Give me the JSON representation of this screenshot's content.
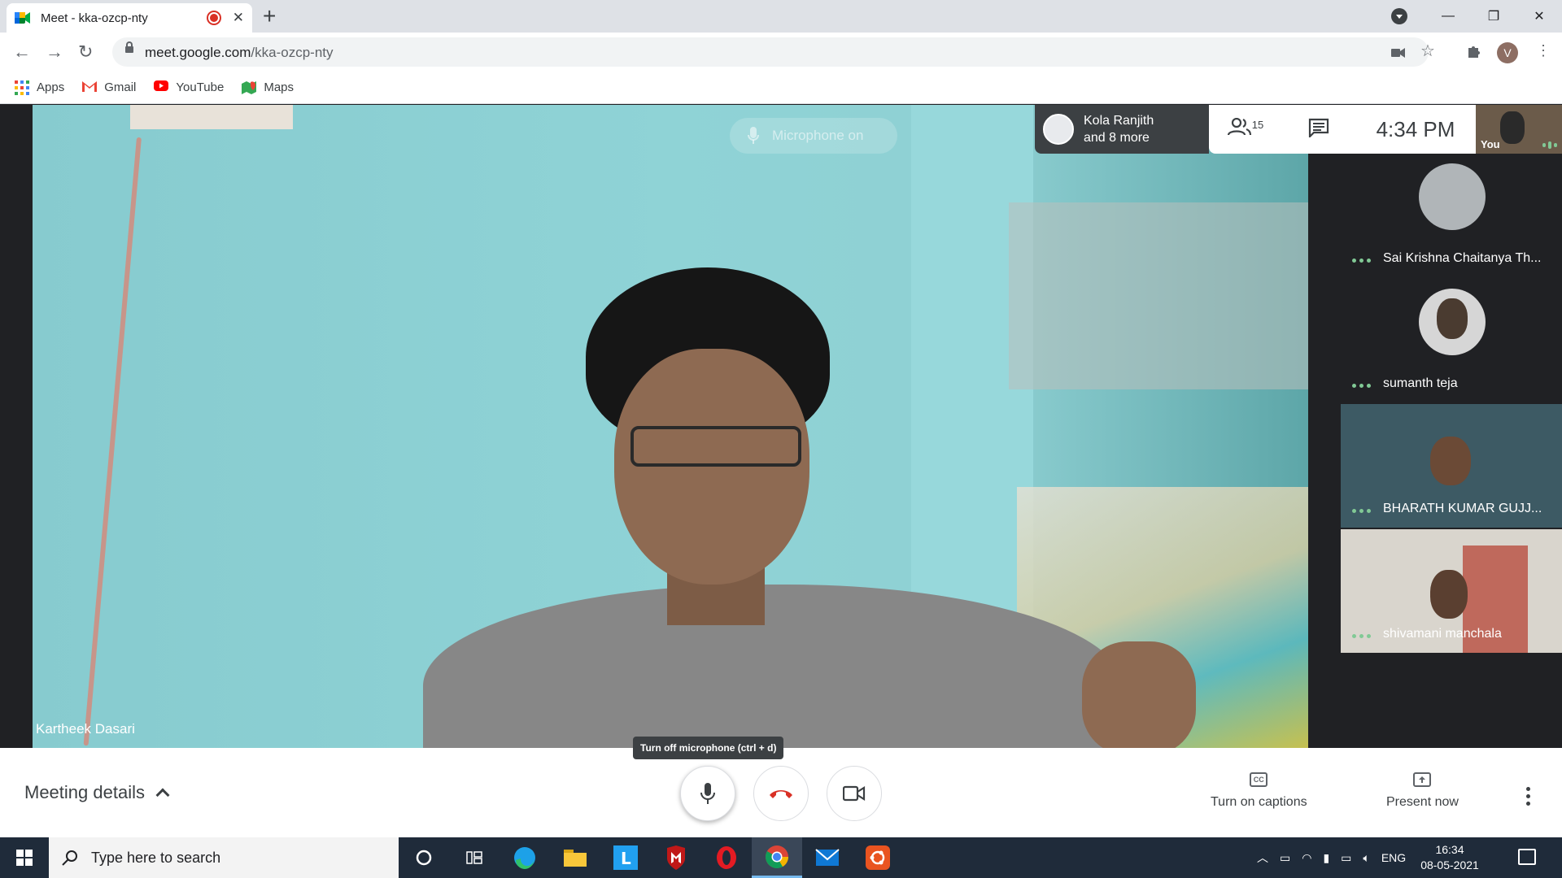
{
  "browser": {
    "tab_title": "Meet - kka-ozcp-nty",
    "url_host": "meet.google.com",
    "url_path": "/kka-ozcp-nty",
    "bookmarks": [
      {
        "label": "Apps"
      },
      {
        "label": "Gmail"
      },
      {
        "label": "YouTube"
      },
      {
        "label": "Maps"
      }
    ],
    "profile_initial": "V"
  },
  "meet": {
    "mic_status": "Microphone on",
    "main_speaker": "Kartheek Dasari",
    "pinned_summary_line1": "Kola Ranjith",
    "pinned_summary_line2": "and 8 more",
    "participant_count": "15",
    "time": "4:34 PM",
    "self_label": "You",
    "side_participants": [
      {
        "name": "Sai Krishna Chaitanya Th..."
      },
      {
        "name": "sumanth teja"
      },
      {
        "name": "BHARATH KUMAR GUJJ..."
      },
      {
        "name": "shivamani manchala"
      }
    ],
    "tooltip": "Turn off microphone (ctrl + d)",
    "meeting_details": "Meeting details",
    "captions_label": "Turn on captions",
    "captions_icon_text": "CC",
    "present_label": "Present now"
  },
  "taskbar": {
    "search_placeholder": "Type here to search",
    "language": "ENG",
    "time": "16:34",
    "date": "08-05-2021"
  },
  "colors": {
    "hangup_red": "#d93025",
    "meet_blue": "#8ab4f8",
    "active_green": "#81c995"
  }
}
